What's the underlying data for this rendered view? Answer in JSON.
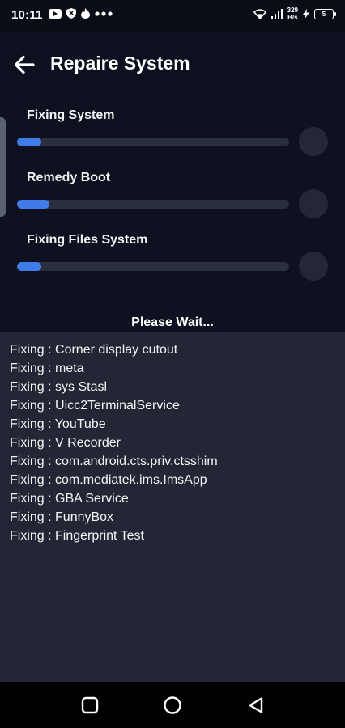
{
  "status_bar": {
    "time": "10:11",
    "speed_value": "329",
    "speed_unit": "B/s",
    "battery": "5"
  },
  "header": {
    "title": "Repaire System"
  },
  "tasks": [
    {
      "label": "Fixing System",
      "progress": 0.09
    },
    {
      "label": "Remedy Boot",
      "progress": 0.12
    },
    {
      "label": "Fixing Files System",
      "progress": 0.09
    }
  ],
  "status": {
    "wait_text": "Please Wait..."
  },
  "log": [
    "Fixing : Corner display cutout",
    "Fixing : meta",
    "Fixing : sys Stasl",
    "Fixing : Uicc2TerminalService",
    "Fixing : YouTube",
    "Fixing : V Recorder",
    "Fixing : com.android.cts.priv.ctsshim",
    "Fixing : com.mediatek.ims.ImsApp",
    "Fixing : GBA Service",
    "Fixing : FunnyBox",
    "Fixing : Fingerprint Test"
  ],
  "colors": {
    "accent": "#3f7ce8",
    "background": "#0e1220",
    "log_background": "#232735"
  }
}
